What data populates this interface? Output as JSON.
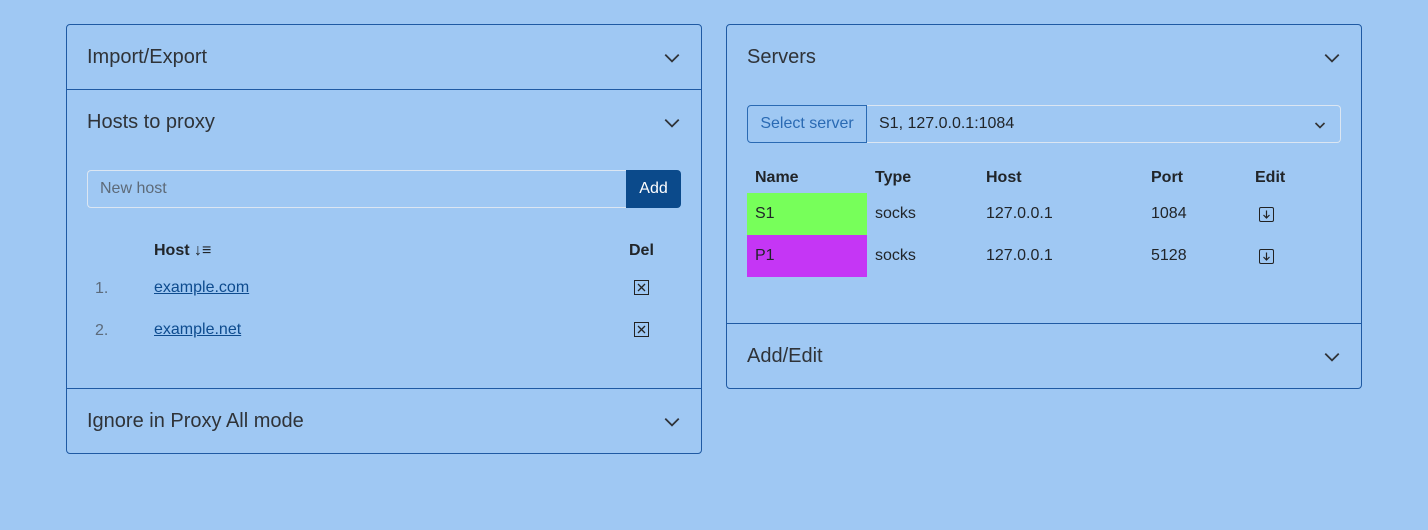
{
  "left": {
    "import_export": {
      "title": "Import/Export"
    },
    "hosts": {
      "title": "Hosts to proxy",
      "input_placeholder": "New host",
      "add_label": "Add",
      "col_host": "Host ↓≡",
      "col_del": "Del",
      "rows": [
        {
          "num": "1.",
          "host": "example.com"
        },
        {
          "num": "2.",
          "host": "example.net"
        }
      ]
    },
    "ignore": {
      "title": "Ignore in Proxy All mode"
    }
  },
  "right": {
    "servers": {
      "title": "Servers",
      "select_label": "Select server",
      "selected": "S1, 127.0.0.1:1084",
      "columns": {
        "name": "Name",
        "type": "Type",
        "host": "Host",
        "port": "Port",
        "edit": "Edit"
      },
      "rows": [
        {
          "name": "S1",
          "type": "socks",
          "host": "127.0.0.1",
          "port": "1084",
          "color": "#77ff5a"
        },
        {
          "name": "P1",
          "type": "socks",
          "host": "127.0.0.1",
          "port": "5128",
          "color": "#c536f5"
        }
      ]
    },
    "add_edit": {
      "title": "Add/Edit"
    }
  },
  "icons": {
    "chevron": "chevron-down-icon",
    "delete": "close-box-icon",
    "edit": "arrow-down-box-icon"
  }
}
